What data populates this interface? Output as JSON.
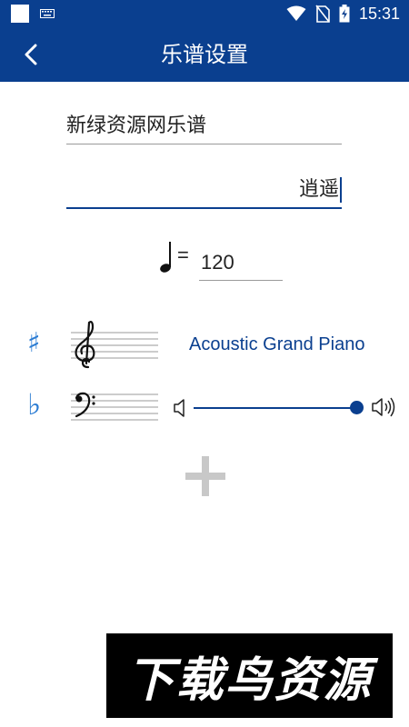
{
  "status_bar": {
    "time": "15:31",
    "icons": [
      "notification-square-icon",
      "keyboard-icon",
      "wifi-icon",
      "no-sim-icon",
      "battery-charging-icon"
    ]
  },
  "app_bar": {
    "title": "乐谱设置",
    "back_icon": "chevron-left-icon"
  },
  "form": {
    "title_value": "新绿资源网乐谱",
    "author_value": "逍遥",
    "tempo_symbol": "=",
    "tempo_value": "120"
  },
  "tracks": [
    {
      "accidental": "♯",
      "clef": "treble-clef-icon",
      "instrument": "Acoustic Grand Piano"
    },
    {
      "accidental": "♭",
      "clef": "bass-clef-icon",
      "volume": 1.0
    }
  ],
  "add_icon": "plus-icon",
  "watermark": {
    "text": "下载鸟资源"
  },
  "colors": {
    "primary": "#0a3f8f",
    "accent": "#2b7cd3",
    "add_button": "#c8c8c8"
  }
}
